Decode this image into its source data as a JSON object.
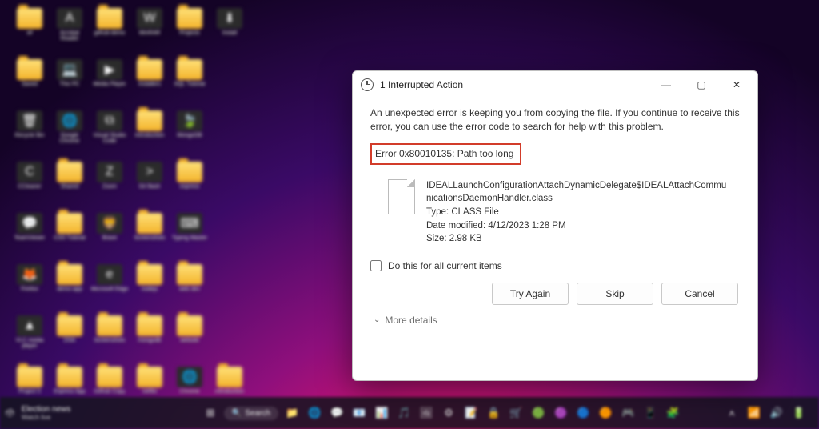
{
  "dialog": {
    "title": "1 Interrupted Action",
    "message": "An unexpected error is keeping you from copying the file. If you continue to receive this error, you can use the error code to search for help with this problem.",
    "error": "Error 0x80010135: Path too long",
    "file": {
      "name": "IDEALLaunchConfigurationAttachDynamicDelegate$IDEALAttachCommunicationsDaemonHandler.class",
      "type_label": "Type:",
      "type": "CLASS File",
      "modified_label": "Date modified:",
      "modified": "4/12/2023 1:28 PM",
      "size_label": "Size:",
      "size": "2.98 KB"
    },
    "checkbox_label": "Do this for all current items",
    "buttons": {
      "try_again": "Try Again",
      "skip": "Skip",
      "cancel": "Cancel"
    },
    "more": "More details"
  },
  "taskbar": {
    "weather": "Election news",
    "weather_sub": "Watch live",
    "search": "Search"
  },
  "desktop_icons": [
    {
      "t": "folder",
      "l": "wf"
    },
    {
      "t": "app",
      "g": "A",
      "l": "Acrobat Reader"
    },
    {
      "t": "folder",
      "l": "github-demo"
    },
    {
      "t": "app",
      "g": "W",
      "l": "WinRAR"
    },
    {
      "t": "folder",
      "l": "Projects"
    },
    {
      "t": "app",
      "g": "⬇",
      "l": "Install"
    },
    {
      "t": "folder",
      "l": "Saved"
    },
    {
      "t": "app",
      "g": "💻",
      "l": "This PC"
    },
    {
      "t": "app",
      "g": "▶",
      "l": "Media Player"
    },
    {
      "t": "folder",
      "l": "Installers"
    },
    {
      "t": "folder",
      "l": "SQL Tutorial"
    },
    {
      "t": "blank"
    },
    {
      "t": "app",
      "g": "🗑",
      "l": "Recycle Bin"
    },
    {
      "t": "round",
      "g": "🌐",
      "l": "Google Chrome"
    },
    {
      "t": "app",
      "g": "⧉",
      "l": "Visual Studio Code"
    },
    {
      "t": "folder",
      "l": "Introduction"
    },
    {
      "t": "round",
      "g": "🍃",
      "l": "MongoDB"
    },
    {
      "t": "blank"
    },
    {
      "t": "app",
      "g": "C",
      "l": "CCleaner"
    },
    {
      "t": "folder",
      "l": "Shared"
    },
    {
      "t": "app",
      "g": "Z",
      "l": "Zoom"
    },
    {
      "t": "app",
      "g": ">",
      "l": "Git Bash"
    },
    {
      "t": "folder",
      "l": "express"
    },
    {
      "t": "blank"
    },
    {
      "t": "round",
      "g": "💬",
      "l": "TeamViewer"
    },
    {
      "t": "folder",
      "l": "CSS Tutorial"
    },
    {
      "t": "app",
      "g": "🦁",
      "l": "Brave"
    },
    {
      "t": "folder",
      "l": "Screenshots"
    },
    {
      "t": "app",
      "g": "⌨",
      "l": "Typing Master"
    },
    {
      "t": "blank"
    },
    {
      "t": "round",
      "g": "🦊",
      "l": "Firefox"
    },
    {
      "t": "folder",
      "l": "demo-app"
    },
    {
      "t": "round",
      "g": "e",
      "l": "Microsoft Edge"
    },
    {
      "t": "folder",
      "l": "nodejs"
    },
    {
      "t": "folder",
      "l": "web dev"
    },
    {
      "t": "blank"
    },
    {
      "t": "app",
      "g": "▲",
      "l": "VLC media player"
    },
    {
      "t": "folder",
      "l": "DSA"
    },
    {
      "t": "folder",
      "l": "Screenshots"
    },
    {
      "t": "folder",
      "l": "mongodb"
    },
    {
      "t": "folder",
      "l": "website"
    },
    {
      "t": "blank"
    },
    {
      "t": "folder",
      "l": "Project 3"
    },
    {
      "t": "folder",
      "l": "Express App"
    },
    {
      "t": "folder",
      "l": "Github Copy"
    },
    {
      "t": "folder",
      "l": "netflix"
    },
    {
      "t": "round",
      "g": "🌐",
      "l": "Chrome"
    },
    {
      "t": "folder",
      "l": "introduction"
    }
  ],
  "taskbar_icons": [
    "⊞",
    "🔍",
    "📁",
    "🌐",
    "💬",
    "📧",
    "📊",
    "🎵",
    "🖼",
    "⚙",
    "📝",
    "🔒",
    "🛒",
    "🟢",
    "🟣",
    "🔵",
    "🟠",
    "🎮",
    "📱",
    "🧩"
  ],
  "tray": {
    "time": "",
    "date": ""
  }
}
